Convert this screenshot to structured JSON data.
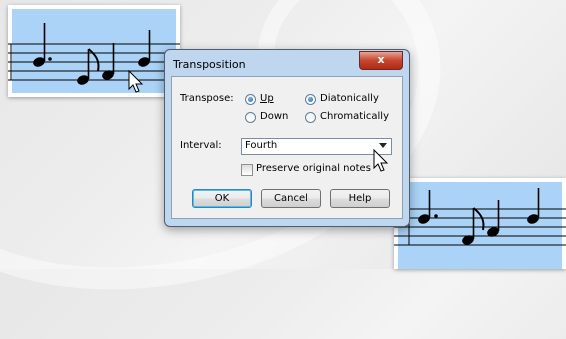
{
  "dialog": {
    "title": "Transposition",
    "close_label": "x",
    "transpose_label": "Transpose:",
    "direction_options": [
      "Up",
      "Down"
    ],
    "direction_selected": "Up",
    "mode_options": [
      "Diatonically",
      "Chromatically"
    ],
    "mode_selected": "Diatonically",
    "interval_label": "Interval:",
    "interval_value": "Fourth",
    "preserve_label": "Preserve original notes",
    "preserve_checked": false,
    "buttons": {
      "ok": "OK",
      "cancel": "Cancel",
      "help": "Help"
    }
  },
  "colors": {
    "staff_bg": "#aad3f7",
    "dialog_frame": "#bed6ee",
    "close_button": "#c7452f"
  },
  "icons": [
    "cursor-icon",
    "close-icon",
    "dropdown-arrow-icon"
  ]
}
